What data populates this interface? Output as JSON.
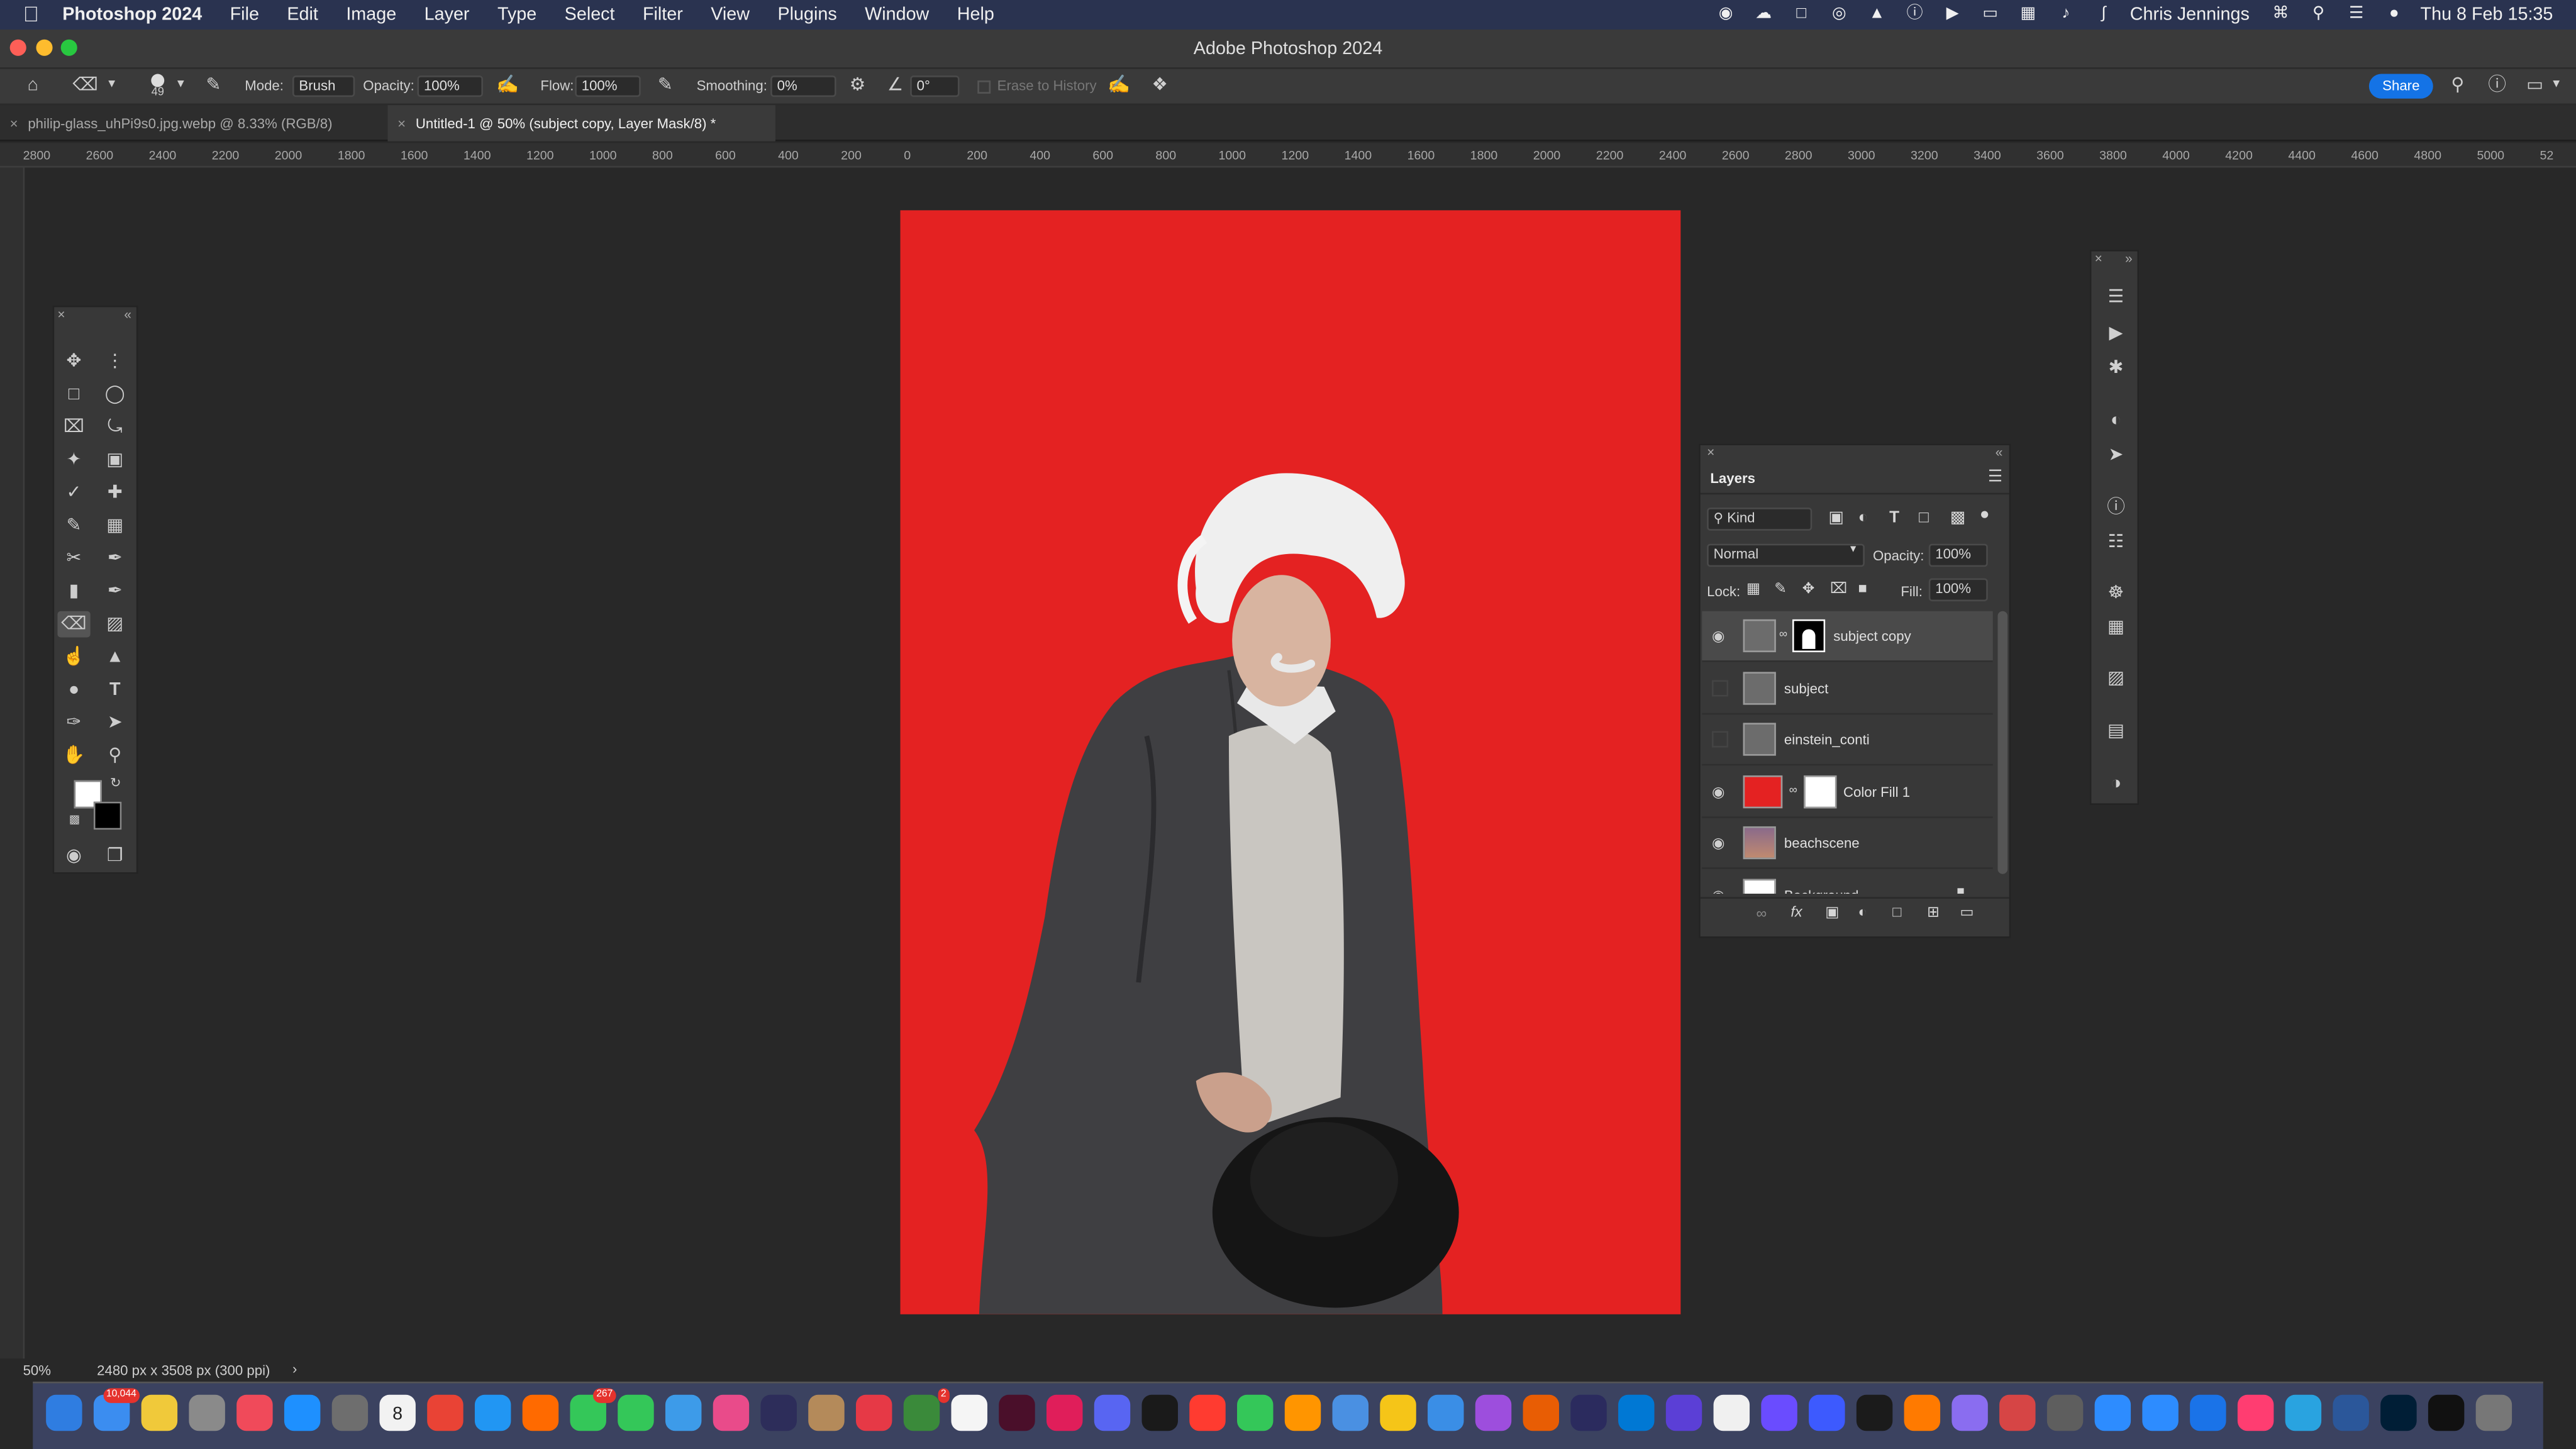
{
  "menubar": {
    "app_name": "Photoshop 2024",
    "menus": [
      "File",
      "Edit",
      "Image",
      "Layer",
      "Type",
      "Select",
      "Filter",
      "View",
      "Plugins",
      "Window",
      "Help"
    ],
    "user": "Chris Jennings",
    "datetime": "Thu 8 Feb  15:35"
  },
  "window": {
    "title": "Adobe Photoshop 2024"
  },
  "options": {
    "brush_size": "49",
    "mode_label": "Mode:",
    "mode_value": "Brush",
    "opacity_label": "Opacity:",
    "opacity_value": "100%",
    "flow_label": "Flow:",
    "flow_value": "100%",
    "smoothing_label": "Smoothing:",
    "smoothing_value": "0%",
    "angle_value": "0°",
    "erase_to_history": "Erase to History",
    "share_label": "Share"
  },
  "tabs": [
    {
      "label": "philip-glass_uhPi9s0.jpg.webp @ 8.33% (RGB/8)"
    },
    {
      "label": "Untitled-1 @ 50% (subject copy, Layer Mask/8) *"
    }
  ],
  "ruler": {
    "marks": [
      "2800",
      "2600",
      "2400",
      "2200",
      "2000",
      "1800",
      "1600",
      "1400",
      "1200",
      "1000",
      "800",
      "600",
      "400",
      "200",
      "0",
      "200",
      "400",
      "600",
      "800",
      "1000",
      "1200",
      "1400",
      "1600",
      "1800",
      "2000",
      "2200",
      "2400",
      "2600",
      "2800",
      "3000",
      "3200",
      "3400",
      "3600",
      "3800",
      "4000",
      "4200",
      "4400",
      "4600",
      "4800",
      "5000",
      "52"
    ]
  },
  "layers_panel": {
    "title": "Layers",
    "filter_kind": "Kind",
    "blend_mode": "Normal",
    "opacity_label": "Opacity:",
    "opacity_value": "100%",
    "lock_label": "Lock:",
    "fill_label": "Fill:",
    "fill_value": "100%",
    "layers": [
      {
        "name": "subject copy",
        "visible": true,
        "selected": true
      },
      {
        "name": "subject",
        "visible": false,
        "selected": false
      },
      {
        "name": "einstein_conti",
        "visible": false,
        "selected": false
      },
      {
        "name": "Color Fill 1",
        "visible": true,
        "selected": false
      },
      {
        "name": "beachscene",
        "visible": true,
        "selected": false
      },
      {
        "name": "Background",
        "visible": true,
        "selected": false
      }
    ]
  },
  "status": {
    "zoom": "50%",
    "doc_size": "2480 px x 3508 px (300 ppi)"
  },
  "colors": {
    "canvas_fill": "#e42222",
    "accent": "#1473e6"
  },
  "dock": {
    "mail_badge": "10,044",
    "messages_badge": "267",
    "reminders_badge": "2",
    "calendar_date": "8"
  }
}
